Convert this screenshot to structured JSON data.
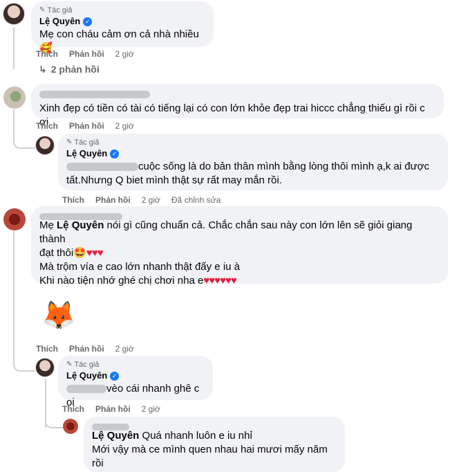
{
  "labels": {
    "author_badge": "Tác giả",
    "like": "Thích",
    "reply": "Phản hồi",
    "edited": "Đã chỉnh sửa"
  },
  "comments": [
    {
      "name": "Lệ Quyên",
      "text": "Mẹ con cháu cảm ơn cả nhà nhiều🥰",
      "time": "2 giờ",
      "replies_link": "2 phản hồi"
    },
    {
      "text": "Xinh đẹp có tiền có tài có tiếng lại có con lớn khỏe đẹp trai hiccc chẳng thiếu gì rồi c ơi",
      "time": "2 giờ",
      "reply": {
        "name": "Lệ Quyên",
        "line1": "cuộc sống là do bản thân mình bằng lòng thôi mình ạ,k ai được",
        "line2": "tất.Nhưng Q biet mình thật sự rất may mắn rồi.",
        "time": "2 giờ"
      }
    },
    {
      "prefix": "Mẹ ",
      "mention": "Lệ Quyên",
      "line1_rest": " nói gì cũng chuẩn cả. Chắc chắn sau này con lớn lên sẽ giỏi giang thành",
      "line2": "đạt thôi🤩",
      "line2_hearts": "♥♥♥",
      "line3": "Mà trộm vía e cao lớn nhanh thật đấy e iu à",
      "line4": "Khi nào tiện nhớ ghé chị chơi nha e",
      "line4_hearts": "♥♥♥♥♥♥",
      "sticker": "🦊",
      "time": "2 giờ",
      "reply": {
        "name": "Lệ Quyên",
        "text": "vèo cái nhanh ghê c oi",
        "time": "2 giờ"
      },
      "reply2": {
        "mention": "Lệ Quyên",
        "line1_rest": " Quá nhanh luôn e iu nhỉ",
        "line2": "Mới vậy mà ce mình quen nhau hai mươi mấy năm rồi"
      }
    }
  ]
}
